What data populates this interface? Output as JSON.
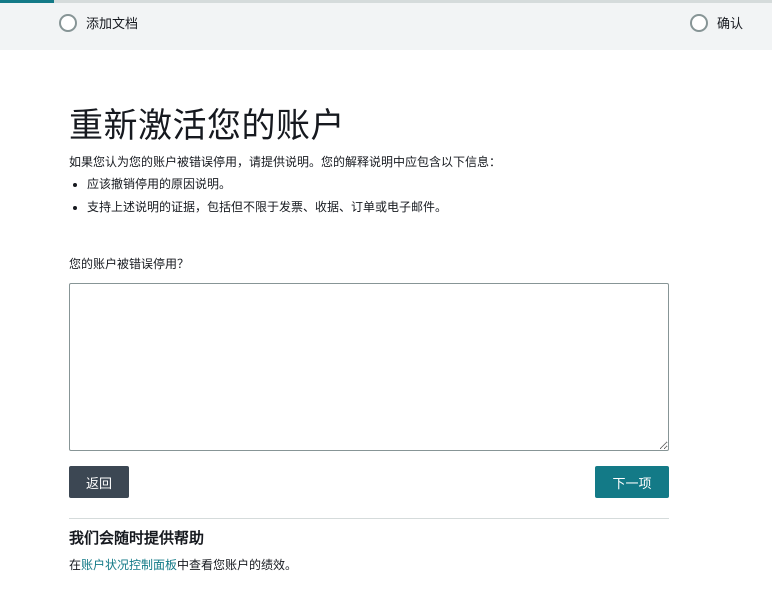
{
  "stepper": {
    "progress_percent": 7,
    "steps": [
      {
        "label": "添加文档"
      },
      {
        "label": "确认"
      }
    ]
  },
  "page": {
    "title": "重新激活您的账户",
    "intro": "如果您认为您的账户被错误停用，请提供说明。您的解释说明中应包含以下信息：",
    "bullets": [
      "应该撤销停用的原因说明。",
      "支持上述说明的证据，包括但不限于发票、收据、订单或电子邮件。"
    ]
  },
  "form": {
    "question_label": "您的账户被错误停用？",
    "textarea_value": ""
  },
  "buttons": {
    "back_label": "返回",
    "next_label": "下一项"
  },
  "help": {
    "title": "我们会随时提供帮助",
    "prefix": "在",
    "link_text": "账户状况控制面板",
    "suffix": "中查看您账户的绩效。"
  },
  "colors": {
    "accent": "#137a87",
    "back_button": "#3c4753",
    "stepper_bg": "#f2f4f5"
  }
}
